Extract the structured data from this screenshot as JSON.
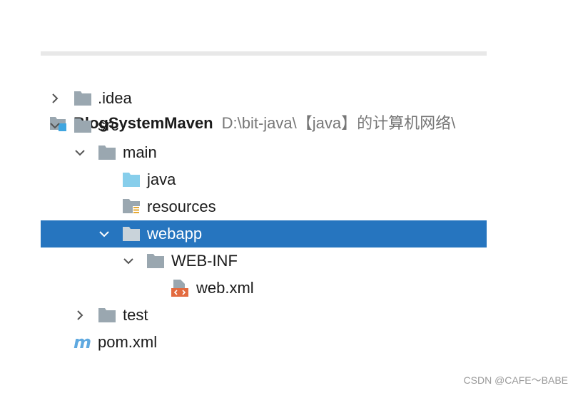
{
  "project": {
    "name": "BlogSystemMaven",
    "path": "D:\\bit-java\\【java】的计算机网络\\"
  },
  "tree": {
    "idea": ".idea",
    "src": "src",
    "main": "main",
    "java": "java",
    "resources": "resources",
    "webapp": "webapp",
    "webinf": "WEB-INF",
    "webxml": "web.xml",
    "test": "test",
    "pom": "pom.xml"
  },
  "icons": {
    "folder": "folder-icon",
    "source_folder": "source-folder-icon",
    "resources_folder": "resources-folder-icon",
    "xml_file": "xml-file-icon",
    "maven": "maven-icon",
    "module": "module-icon"
  },
  "colors": {
    "selection": "#2675bf",
    "folder": "#9aa7b0",
    "source_folder": "#87ceeb",
    "xml": "#e36b40",
    "maven": "#5fa9e0"
  },
  "watermark": "CSDN @CAFE～BABE"
}
